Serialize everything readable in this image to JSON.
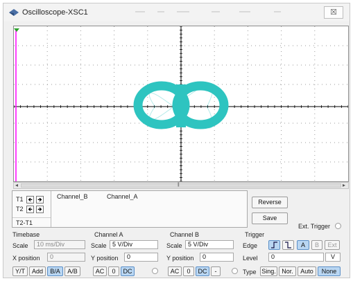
{
  "window": {
    "title": "Oscilloscope-XSC1",
    "close_glyph": "☒"
  },
  "icons": {
    "title": "oscilloscope-icon",
    "close": "close-icon",
    "cursor_left": "arrow-left-icon",
    "cursor_right": "arrow-right-icon"
  },
  "colors": {
    "trace": "#2ec4c0",
    "cursor_t1": "#ff00ff",
    "cursor_t2_marker": "#2aa02a",
    "selected": "#b9d6f2"
  },
  "cursors": {
    "t1": "T1",
    "t2": "T2",
    "t2t1": "T2-T1",
    "columns": [
      "Channel_B",
      "Channel_A"
    ]
  },
  "buttons": {
    "reverse": "Reverse",
    "save": "Save"
  },
  "ext_trigger": "Ext. Trigger",
  "timebase": {
    "title": "Timebase",
    "scale_label": "Scale",
    "scale": "10 ms/Div",
    "xpos_label": "X position",
    "xpos": "0",
    "modes": [
      "Y/T",
      "Add",
      "B/A",
      "A/B"
    ],
    "selected_mode": "B/A"
  },
  "channel_a": {
    "title": "Channel A",
    "scale_label": "Scale",
    "scale": "5  V/Div",
    "ypos_label": "Y position",
    "ypos": "0",
    "coupling": [
      "AC",
      "0",
      "DC"
    ],
    "selected_coupling": "DC"
  },
  "channel_b": {
    "title": "Channel B",
    "scale_label": "Scale",
    "scale": "5  V/Div",
    "ypos_label": "Y position",
    "ypos": "0",
    "coupling": [
      "AC",
      "0",
      "DC",
      "-"
    ],
    "selected_coupling": "DC"
  },
  "trigger": {
    "title": "Trigger",
    "edge_label": "Edge",
    "sources": [
      "A",
      "B",
      "Ext"
    ],
    "selected_source": "A",
    "level_label": "Level",
    "level": "0",
    "level_unit": "V",
    "type_label": "Type",
    "types": [
      "Sing.",
      "Nor.",
      "Auto",
      "None"
    ],
    "selected_type": "None"
  }
}
